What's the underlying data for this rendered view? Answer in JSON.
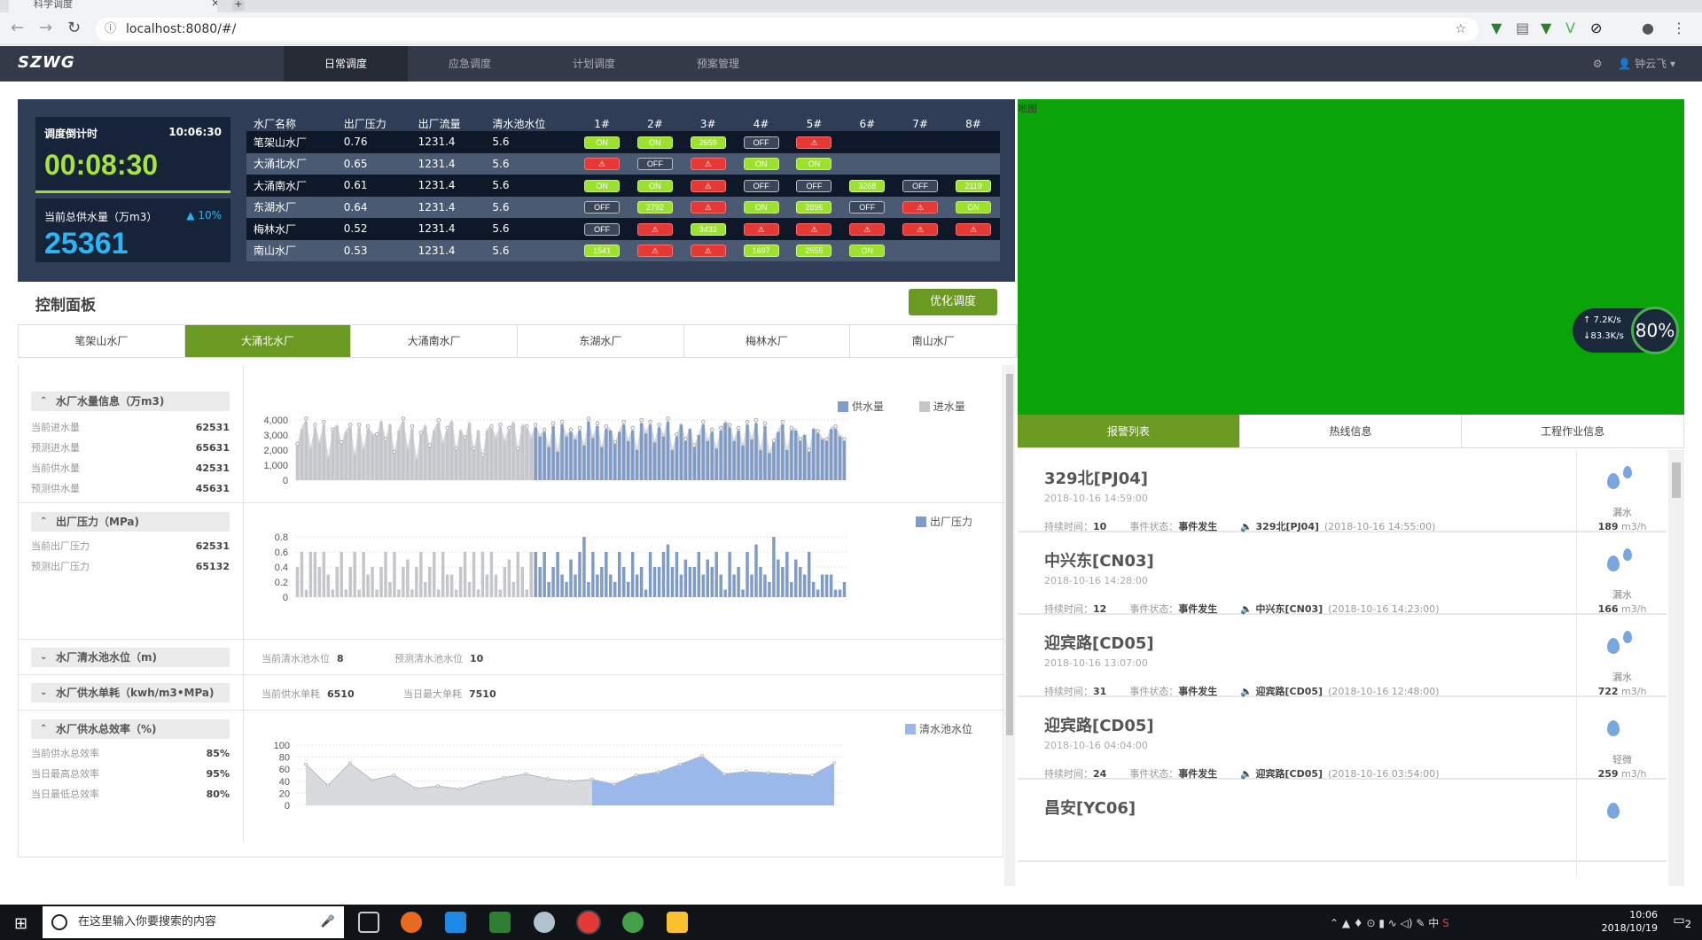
{
  "browser": {
    "tab_title": "科学调度",
    "url": "localhost:8080/#/"
  },
  "app": {
    "logo": "SZWG",
    "nav": [
      "日常调度",
      "应急调度",
      "计划调度",
      "预案管理"
    ],
    "user": "钟云飞"
  },
  "dispatch": {
    "countdown_title": "调度倒计时",
    "clock": "10:06:30",
    "countdown": "00:08:30",
    "supply_title": "当前总供水量（万m3）",
    "supply_delta": "▲ 10%",
    "supply_value": "25361",
    "headers": [
      "水厂名称",
      "出厂压力",
      "出厂流量",
      "清水池水位",
      "1#",
      "2#",
      "3#",
      "4#",
      "5#",
      "6#",
      "7#",
      "8#"
    ],
    "rows": [
      {
        "name": "笔架山水厂",
        "pressure": "0.76",
        "flow": "1231.4",
        "level": "5.6",
        "status": [
          "ON",
          "ON",
          "2659",
          "OFF",
          "!",
          "",
          "",
          ""
        ]
      },
      {
        "name": "大涌北水厂",
        "pressure": "0.65",
        "flow": "1231.4",
        "level": "5.6",
        "status": [
          "!",
          "OFF",
          "!",
          "ON",
          "ON",
          "",
          "",
          ""
        ]
      },
      {
        "name": "大涌南水厂",
        "pressure": "0.61",
        "flow": "1231.4",
        "level": "5.6",
        "status": [
          "ON",
          "ON",
          "!",
          "OFF",
          "OFF",
          "3268",
          "OFF",
          "2119"
        ]
      },
      {
        "name": "东湖水厂",
        "pressure": "0.64",
        "flow": "1231.4",
        "level": "5.6",
        "status": [
          "OFF",
          "2792",
          "!",
          "ON",
          "2896",
          "OFF",
          "!",
          "ON"
        ]
      },
      {
        "name": "梅林水厂",
        "pressure": "0.52",
        "flow": "1231.4",
        "level": "5.6",
        "status": [
          "OFF",
          "!",
          "3433",
          "!",
          "!",
          "!",
          "!",
          "!"
        ]
      },
      {
        "name": "南山水厂",
        "pressure": "0.53",
        "flow": "1231.4",
        "level": "5.6",
        "status": [
          "1541",
          "!",
          "!",
          "1697",
          "2555",
          "ON",
          "",
          ""
        ]
      }
    ]
  },
  "control": {
    "title": "控制面板",
    "optimize": "优化调度",
    "plant_tabs": [
      "笔架山水厂",
      "大涌北水厂",
      "大涌南水厂",
      "东湖水厂",
      "梅林水厂",
      "南山水厂"
    ],
    "active_tab": 1,
    "water": {
      "title": "水厂水量信息（万m3)",
      "items": [
        {
          "label": "当前进水量",
          "value": "62531"
        },
        {
          "label": "预测进水量",
          "value": "65631"
        },
        {
          "label": "当前供水量",
          "value": "42531"
        },
        {
          "label": "预测供水量",
          "value": "45631"
        }
      ]
    },
    "pressure": {
      "title": "出厂压力（MPa)",
      "items": [
        {
          "label": "当前出厂压力",
          "value": "62531"
        },
        {
          "label": "预测出厂压力",
          "value": "65132"
        }
      ]
    },
    "level": {
      "title": "水厂清水池水位（m)",
      "current_label": "当前清水池水位",
      "current_value": "8",
      "forecast_label": "预测清水池水位",
      "forecast_value": "10"
    },
    "unit": {
      "title": "水厂供水单耗（kwh/m3•MPa)",
      "current_label": "当前供水单耗",
      "current_value": "6510",
      "max_label": "当日最大单耗",
      "max_value": "7510"
    },
    "efficiency": {
      "title": "水厂供水总效率（%)",
      "items": [
        {
          "label": "当前供水总效率",
          "value": "85%"
        },
        {
          "label": "当日最高总效率",
          "value": "95%"
        },
        {
          "label": "当日最低总效率",
          "value": "80%"
        }
      ]
    }
  },
  "chart_data": [
    {
      "type": "bar",
      "series": [
        {
          "name": "供水量",
          "color": "#7f9cc9",
          "values": [
            2300,
            3400,
            3900,
            2100,
            3500,
            2500,
            3700,
            1500,
            3200,
            3600,
            2400,
            3200,
            3500,
            1700,
            3500,
            2100,
            3400,
            3000,
            2900,
            3900,
            2600,
            3700,
            1800,
            3300,
            3900,
            2100,
            3400,
            1400,
            3000,
            3600,
            2200,
            3300,
            3800,
            2500,
            3300,
            3900,
            2000,
            3300,
            2700,
            3800,
            2000,
            3300,
            1600,
            3300,
            3400,
            2800,
            3500,
            2600,
            3300,
            3800,
            2000,
            3600,
            3400,
            2800,
            3500,
            2900,
            3200,
            2200,
            3600,
            1900,
            3700,
            2900,
            3200,
            2700,
            3300,
            2300,
            3900,
            2800,
            3600,
            2200,
            3400,
            3300,
            2400,
            3200,
            3700,
            2600,
            3300,
            2000,
            3800,
            3100,
            3700,
            2500,
            3500,
            2900,
            3900,
            2000,
            2900,
            3700,
            2600,
            3400,
            2200,
            3000,
            3700,
            2600,
            3200,
            2100,
            3300,
            3800,
            3500,
            2600,
            3300,
            2300,
            3700,
            2700,
            3800,
            2000,
            3600,
            1800,
            2500,
            3200,
            3700,
            2000,
            3300,
            3300,
            2600,
            3000,
            1900,
            3400,
            3100,
            2700,
            2600,
            3400,
            3400,
            2900,
            2600
          ]
        },
        {
          "name": "进水量",
          "color": "#c4c6ca",
          "values": [
            2300,
            3400,
            3900,
            2100,
            3500,
            2500,
            3700,
            1500,
            3200,
            3600,
            2400,
            3200,
            3500,
            1700,
            3500,
            2100,
            3400,
            3000,
            2900,
            3900,
            2600,
            3700,
            1800,
            3300,
            3900,
            2100,
            3400,
            1400,
            3000,
            3600,
            2200,
            3300,
            3800,
            2500,
            3300,
            3900,
            2000,
            3300,
            2700,
            3800,
            2000,
            3300,
            1600,
            3300,
            3400,
            2800,
            3500,
            2600,
            3300,
            3800,
            2000,
            3600,
            3400,
            2800,
            3500,
            2900,
            3200,
            2200,
            3600,
            1900,
            3700,
            2900,
            3200,
            2700,
            3300,
            2300,
            3900,
            2800,
            3600,
            2200,
            3400,
            3300,
            2400,
            3200,
            3700,
            2600,
            3300,
            2000,
            3800,
            3100,
            3700,
            2500,
            3500,
            2900,
            3900,
            2000,
            2900,
            3700,
            2600,
            3400,
            2200,
            3000,
            3700,
            2600,
            3200,
            2100,
            3300,
            3800,
            3500,
            2600,
            3300,
            2300,
            3700,
            2700,
            3800,
            2000,
            3600,
            1800,
            2500,
            3200,
            3700,
            2000,
            3300,
            3300,
            2600,
            3000,
            1900,
            3400,
            3100,
            2700,
            2600,
            3400,
            3400,
            2900,
            2600
          ]
        }
      ],
      "split_index": 54,
      "ylim": [
        0,
        4000
      ],
      "yticks": [
        "0",
        "1,000",
        "2,000",
        "3,000",
        "4,000"
      ],
      "legend": [
        "供水量",
        "进水量"
      ],
      "legend_position": "top-right"
    },
    {
      "type": "bar",
      "series": [
        {
          "name": "出厂压力",
          "color": "#7f9cc9",
          "values": [
            0.4,
            0.6,
            0.1,
            0.6,
            0.6,
            0.4,
            0.6,
            0.3,
            0.1,
            0.4,
            0.6,
            0.1,
            0.4,
            0.6,
            0.1,
            0.6,
            0.3,
            0.4,
            0.1,
            0.4,
            0.6,
            0.2,
            0.6,
            0.1,
            0.4,
            0.5,
            0.1,
            0.4,
            0.6,
            0.2,
            0.4,
            0.6,
            0.1,
            0.6,
            0.3,
            0.3,
            0.1,
            0.4,
            0.6,
            0.2,
            0.6,
            0.1,
            0.6,
            0.3,
            0.6,
            0.3,
            0.1,
            0.4,
            0.5,
            0.2,
            0.6,
            0.4,
            0.1,
            0.6,
            0.6,
            0.4,
            0.6,
            0.2,
            0.4,
            0.6,
            0.3,
            0.2,
            0.5,
            0.3,
            0.6,
            0.8,
            0.2,
            0.6,
            0.3,
            0.4,
            0.6,
            0.3,
            0.2,
            0.6,
            0.4,
            0.2,
            0.6,
            0.3,
            0.4,
            0.1,
            0.6,
            0.4,
            0.4,
            0.6,
            0.7,
            0.4,
            0.6,
            0.3,
            0.5,
            0.4,
            0.4,
            0.6,
            0.3,
            0.5,
            0.4,
            0.6,
            0.3,
            0.1,
            0.6,
            0.3,
            0.4,
            0.1,
            0.6,
            0.3,
            0.7,
            0.4,
            0.3,
            0.2,
            0.8,
            0.5,
            0.4,
            0.6,
            0.2,
            0.5,
            0.4,
            0.3,
            0.6,
            0.2,
            0.1,
            0.3,
            0.3,
            0.3,
            0.1,
            0.1,
            0.2
          ]
        }
      ],
      "split_index": 54,
      "ylim": [
        0,
        0.8
      ],
      "yticks": [
        "0",
        "0.2",
        "0.4",
        "0.6",
        "0.8"
      ],
      "legend": [
        "出厂压力"
      ],
      "legend_position": "top-right"
    },
    {
      "type": "area",
      "series": [
        {
          "name": "清水池水位",
          "color": "#9ab8ea",
          "values": [
            68,
            33,
            70,
            42,
            50,
            28,
            32,
            27,
            38,
            46,
            52,
            44,
            40,
            43,
            35,
            50,
            55,
            68,
            82,
            52,
            56,
            54,
            52,
            50,
            70
          ]
        }
      ],
      "split_index": 13,
      "ylim": [
        0,
        100
      ],
      "yticks": [
        "0",
        "20",
        "40",
        "60",
        "80",
        "100"
      ],
      "legend": [
        "清水池水位"
      ],
      "legend_position": "top-right"
    }
  ],
  "map": {
    "label": "地图",
    "up_speed": "↑ 7.2K/s",
    "down_speed": "↓83.3K/s",
    "gauge": "80%"
  },
  "right_tabs": [
    "报警列表",
    "热线信息",
    "工程作业信息"
  ],
  "alarms": [
    {
      "title": "329北[PJ04]",
      "date": "2018-10-16 14:59:00",
      "dur_label": "持续时间：",
      "duration": "10",
      "state_label": "事件状态：",
      "state": "事件发生",
      "source": "329北[PJ04]",
      "source_time": "(2018-10-16 14:55:00)",
      "kind": "漏水",
      "rate": "189",
      "unit": "m3/h"
    },
    {
      "title": "中兴东[CN03]",
      "date": "2018-10-16 14:28:00",
      "dur_label": "持续时间：",
      "duration": "12",
      "state_label": "事件状态：",
      "state": "事件发生",
      "source": "中兴东[CN03]",
      "source_time": "(2018-10-16 14:23:00)",
      "kind": "漏水",
      "rate": "166",
      "unit": "m3/h"
    },
    {
      "title": "迎宾路[CD05]",
      "date": "2018-10-16 13:07:00",
      "dur_label": "持续时间：",
      "duration": "31",
      "state_label": "事件状态：",
      "state": "事件发生",
      "source": "迎宾路[CD05]",
      "source_time": "(2018-10-16 12:48:00)",
      "kind": "漏水",
      "rate": "722",
      "unit": "m3/h"
    },
    {
      "title": "迎宾路[CD05]",
      "date": "2018-10-16 04:04:00",
      "dur_label": "持续时间：",
      "duration": "24",
      "state_label": "事件状态：",
      "state": "事件发生",
      "source": "迎宾路[CD05]",
      "source_time": "(2018-10-16 03:54:00)",
      "kind": "轻微",
      "rate": "259",
      "unit": "m3/h"
    },
    {
      "title": "昌安[YC06]",
      "date": "",
      "dur_label": "",
      "duration": "",
      "state_label": "",
      "state": "",
      "source": "",
      "source_time": "",
      "kind": "",
      "rate": "",
      "unit": ""
    }
  ],
  "taskbar": {
    "search_placeholder": "在这里输入你要搜索的内容",
    "time": "10:06",
    "date": "2018/10/19",
    "ime": "中",
    "notif": "2"
  }
}
